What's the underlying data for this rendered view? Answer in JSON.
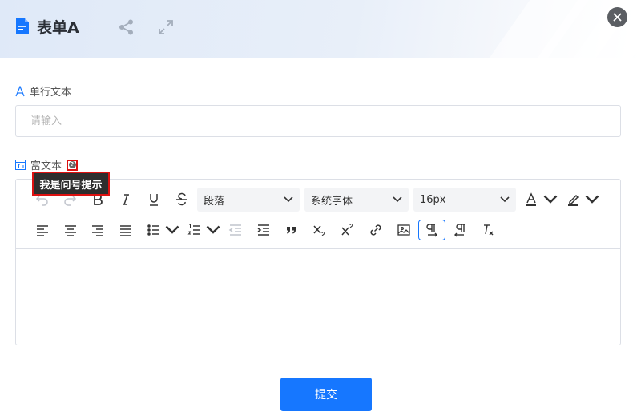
{
  "header": {
    "title": "表单A",
    "icons": [
      "document-icon",
      "share-icon",
      "expand-icon",
      "close-icon"
    ]
  },
  "form": {
    "field1": {
      "label": "单行文本",
      "placeholder": "请输入",
      "value": ""
    },
    "field2": {
      "label": "富文本",
      "tooltip": "我是问号提示"
    }
  },
  "toolbar": {
    "paragraph": "段落",
    "font": "系统字体",
    "size": "16px"
  },
  "submit_label": "提交",
  "colors": {
    "accent": "#1677ff",
    "highlight_border": "#dd1111",
    "tooltip_bg": "#2e2e2e"
  }
}
